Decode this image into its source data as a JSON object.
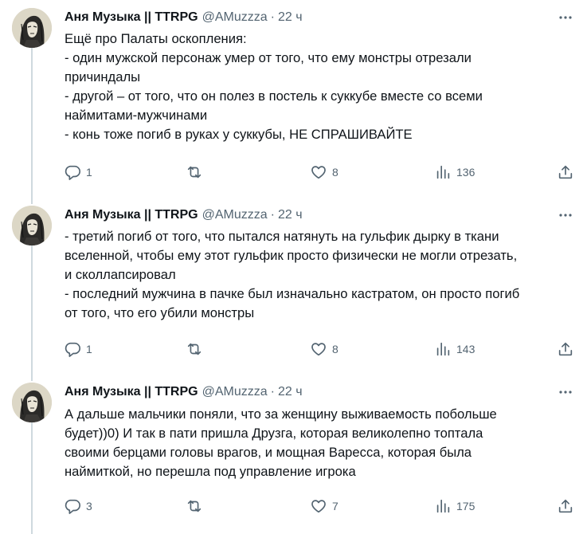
{
  "tweets": [
    {
      "author": {
        "name": "Аня Музыка || TTRPG",
        "handle": "@AMuzzza",
        "separator": "·",
        "time": "22 ч"
      },
      "lines": [
        "Ещё про Палаты оскопления:",
        "- один мужской персонаж умер от того, что ему монстры отрезали",
        "причиндалы",
        "- другой – от того, что он полез в постель к суккубе вместе со всеми",
        "наймитами-мужчинами",
        "- конь тоже погиб в руках у суккубы, НЕ СПРАШИВАЙТЕ"
      ],
      "stats": {
        "replies": "1",
        "retweets": "",
        "likes": "8",
        "views": "136"
      }
    },
    {
      "author": {
        "name": "Аня Музыка || TTRPG",
        "handle": "@AMuzzza",
        "separator": "·",
        "time": "22 ч"
      },
      "lines": [
        "- третий погиб от того, что пытался натянуть на гульфик дырку в ткани",
        "вселенной, чтобы ему этот гульфик просто физически не могли отрезать,",
        "и сколлапсировал",
        "- последний мужчина в пачке был изначально кастратом, он просто погиб",
        "от того, что его убили монстры"
      ],
      "stats": {
        "replies": "1",
        "retweets": "",
        "likes": "8",
        "views": "143"
      }
    },
    {
      "author": {
        "name": "Аня Музыка || TTRPG",
        "handle": "@AMuzzza",
        "separator": "·",
        "time": "22 ч"
      },
      "lines": [
        "А дальше мальчики поняли, что за женщину выживаемость побольше",
        "будет))0) И так в пати пришла Друзга, которая великолепно топтала",
        "своими берцами головы врагов, и мощная Варесса, которая была",
        "наймиткой, но перешла под управление игрока"
      ],
      "stats": {
        "replies": "3",
        "retweets": "",
        "likes": "7",
        "views": "175"
      }
    }
  ],
  "icons": {
    "reply": "reply-icon",
    "retweet": "retweet-icon",
    "like": "heart-icon",
    "views": "views-icon",
    "share": "share-icon",
    "more": "more-dots-icon"
  },
  "colors": {
    "text": "#0f1419",
    "secondary": "#536471",
    "thread_line": "#cfd9de",
    "background": "#ffffff"
  }
}
